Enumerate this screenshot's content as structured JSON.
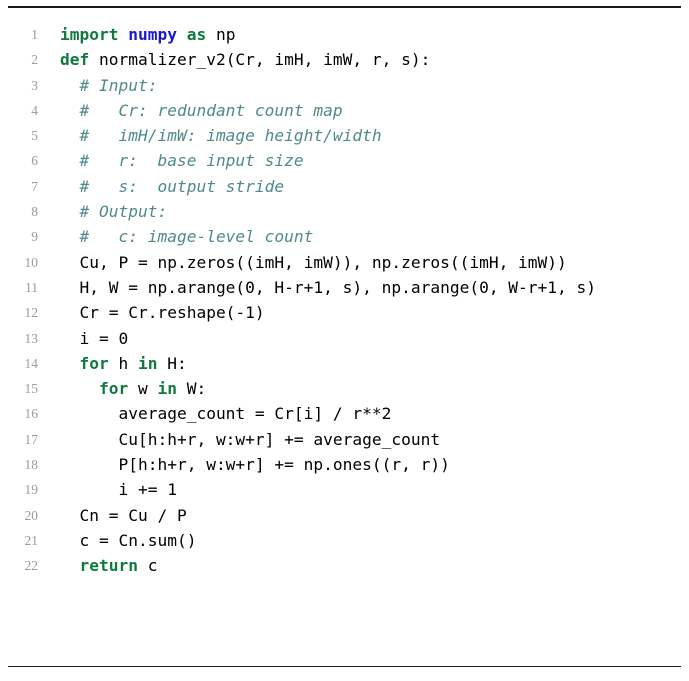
{
  "listing": {
    "language": "python",
    "colors": {
      "keyword": "#10793f",
      "module": "#1818cf",
      "comment": "#4f8a8b",
      "plain": "#000000",
      "lineno": "#9b9b9b",
      "rule": "#1a1a1a",
      "background": "#ffffff"
    },
    "rules": {
      "top": true,
      "bottom": true
    },
    "lines": [
      {
        "number": "1",
        "tokens": [
          {
            "t": "import",
            "c": "kw"
          },
          {
            "t": " ",
            "c": "pl"
          },
          {
            "t": "numpy",
            "c": "mod"
          },
          {
            "t": " ",
            "c": "pl"
          },
          {
            "t": "as",
            "c": "kw"
          },
          {
            "t": " np",
            "c": "pl"
          }
        ]
      },
      {
        "number": "2",
        "tokens": [
          {
            "t": "def",
            "c": "kw"
          },
          {
            "t": " normalizer_v2(Cr, imH, imW, r, s):",
            "c": "pl"
          }
        ]
      },
      {
        "number": "3",
        "tokens": [
          {
            "t": "  # Input:",
            "c": "cm"
          }
        ]
      },
      {
        "number": "4",
        "tokens": [
          {
            "t": "  #   Cr: redundant count map",
            "c": "cm"
          }
        ]
      },
      {
        "number": "5",
        "tokens": [
          {
            "t": "  #   imH/imW: image height/width",
            "c": "cm"
          }
        ]
      },
      {
        "number": "6",
        "tokens": [
          {
            "t": "  #   r:  base input size",
            "c": "cm"
          }
        ]
      },
      {
        "number": "7",
        "tokens": [
          {
            "t": "  #   s:  output stride",
            "c": "cm"
          }
        ]
      },
      {
        "number": "8",
        "tokens": [
          {
            "t": "  # Output:",
            "c": "cm"
          }
        ]
      },
      {
        "number": "9",
        "tokens": [
          {
            "t": "  #   c: image-level count",
            "c": "cm"
          }
        ]
      },
      {
        "number": "10",
        "tokens": [
          {
            "t": "  Cu, P = np.zeros((imH, imW)), np.zeros((imH, imW))",
            "c": "pl"
          }
        ]
      },
      {
        "number": "11",
        "tokens": [
          {
            "t": "  H, W = np.arange(0, H-r+1, s), np.arange(0, W-r+1, s)",
            "c": "pl"
          }
        ]
      },
      {
        "number": "12",
        "tokens": [
          {
            "t": "  Cr = Cr.reshape(-1)",
            "c": "pl"
          }
        ]
      },
      {
        "number": "13",
        "tokens": [
          {
            "t": "  i = 0",
            "c": "pl"
          }
        ]
      },
      {
        "number": "14",
        "tokens": [
          {
            "t": "  ",
            "c": "pl"
          },
          {
            "t": "for",
            "c": "kw"
          },
          {
            "t": " h ",
            "c": "pl"
          },
          {
            "t": "in",
            "c": "kw"
          },
          {
            "t": " H:",
            "c": "pl"
          }
        ]
      },
      {
        "number": "15",
        "tokens": [
          {
            "t": "    ",
            "c": "pl"
          },
          {
            "t": "for",
            "c": "kw"
          },
          {
            "t": " w ",
            "c": "pl"
          },
          {
            "t": "in",
            "c": "kw"
          },
          {
            "t": " W:",
            "c": "pl"
          }
        ]
      },
      {
        "number": "16",
        "tokens": [
          {
            "t": "      average_count = Cr[i] / r**2",
            "c": "pl"
          }
        ]
      },
      {
        "number": "17",
        "tokens": [
          {
            "t": "      Cu[h:h+r, w:w+r] += average_count",
            "c": "pl"
          }
        ]
      },
      {
        "number": "18",
        "tokens": [
          {
            "t": "      P[h:h+r, w:w+r] += np.ones((r, r))",
            "c": "pl"
          }
        ]
      },
      {
        "number": "19",
        "tokens": [
          {
            "t": "      i += 1",
            "c": "pl"
          }
        ]
      },
      {
        "number": "20",
        "tokens": [
          {
            "t": "  Cn = Cu / P",
            "c": "pl"
          }
        ]
      },
      {
        "number": "21",
        "tokens": [
          {
            "t": "  c = Cn.sum()",
            "c": "pl"
          }
        ]
      },
      {
        "number": "22",
        "tokens": [
          {
            "t": "  ",
            "c": "pl"
          },
          {
            "t": "return",
            "c": "kw"
          },
          {
            "t": " c",
            "c": "pl"
          }
        ]
      }
    ]
  }
}
